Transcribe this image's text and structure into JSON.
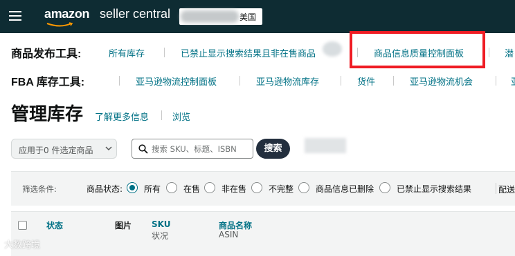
{
  "header": {
    "brand_amazon": "amazon",
    "brand_sc": "seller central",
    "region": "美国",
    "accent": "#0e2c33"
  },
  "product_tools": {
    "title": "商品发布工具:",
    "links": [
      "所有库存",
      "已禁止显示搜索结果且非在售商品",
      "商品信息质量控制面板",
      "潜"
    ]
  },
  "fba_tools": {
    "title": "FBA 库存工具:",
    "links": [
      "亚马逊物流控制面板",
      "亚马逊物流库存",
      "货件",
      "亚马逊物流机会",
      "亚"
    ]
  },
  "page": {
    "title": "管理库存",
    "learn_more": "了解更多信息",
    "browse": "浏览"
  },
  "search": {
    "bulk_select_label": "应用于0 件选定商品",
    "placeholder": "搜索 SKU、标题、ISBN",
    "button": "搜索"
  },
  "filters": {
    "label": "筛选条件:",
    "status_label": "商品状态:",
    "options": [
      {
        "label": "所有",
        "checked": true
      },
      {
        "label": "在售",
        "checked": false
      },
      {
        "label": "非在售",
        "checked": false
      },
      {
        "label": "不完整",
        "checked": false
      },
      {
        "label": "商品信息已删除",
        "checked": false
      },
      {
        "label": "已禁止显示搜索结果",
        "checked": false
      }
    ],
    "next_label": "配送"
  },
  "table": {
    "columns": [
      {
        "label": "状态",
        "sub": ""
      },
      {
        "label": "图片",
        "sub": ""
      },
      {
        "label": "SKU",
        "sub": "状况"
      },
      {
        "label": "商品名称",
        "sub": "ASIN"
      }
    ]
  },
  "watermark": "大数跨境",
  "colors": {
    "link": "#007185",
    "highlight": "#ef1c24",
    "search_button": "#232f3e"
  }
}
